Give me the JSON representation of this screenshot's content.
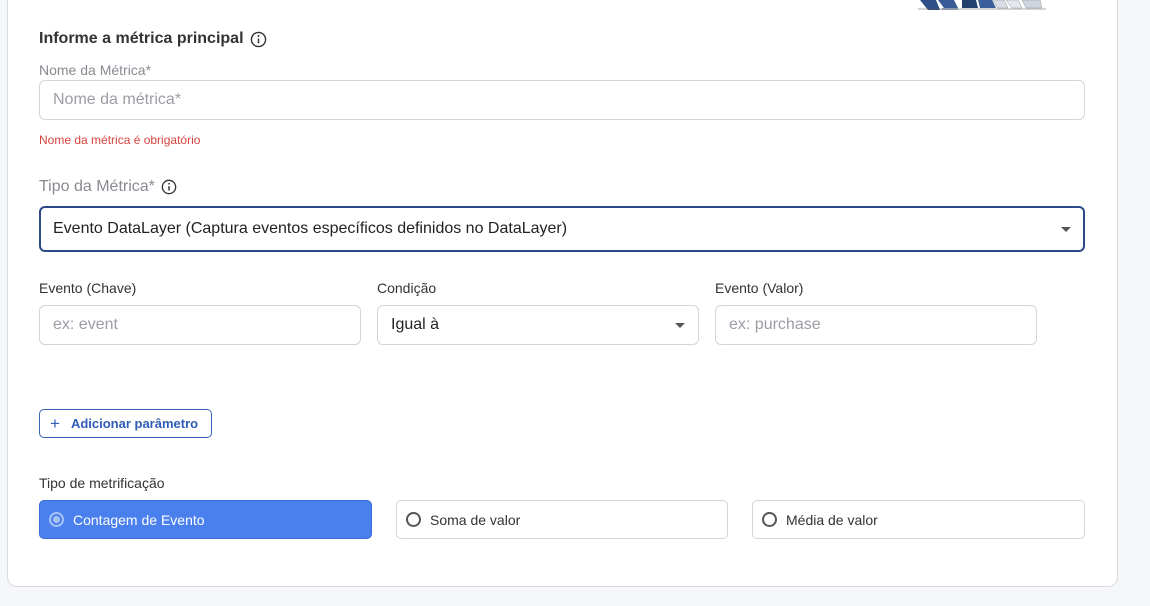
{
  "section": {
    "title": "Informe a métrica principal",
    "info_icon": "info-circle-icon"
  },
  "metric_name": {
    "label": "Nome da Métrica*",
    "placeholder": "Nome da métrica*",
    "value": "",
    "error": "Nome da métrica é obrigatório"
  },
  "metric_type": {
    "label": "Tipo da Métrica*",
    "info_icon": "info-circle-icon",
    "selected": "Evento DataLayer (Captura eventos específicos definidos no DataLayer)"
  },
  "event_key": {
    "label": "Evento (Chave)",
    "placeholder": "ex: event",
    "value": ""
  },
  "condition": {
    "label": "Condição",
    "selected": "Igual à"
  },
  "event_value": {
    "label": "Evento (Valor)",
    "placeholder": "ex: purchase",
    "value": ""
  },
  "add_parameter": {
    "icon": "plus-icon",
    "label": "Adicionar parâmetro"
  },
  "metrification": {
    "label": "Tipo de metrificação",
    "options": [
      {
        "label": "Contagem de Evento",
        "selected": true
      },
      {
        "label": "Soma de valor",
        "selected": false
      },
      {
        "label": "Média de valor",
        "selected": false
      }
    ]
  },
  "colors": {
    "accent": "#4a80ee",
    "focus_border": "#2c4a8a",
    "error": "#d9433f",
    "button_text": "#2f5db8"
  }
}
